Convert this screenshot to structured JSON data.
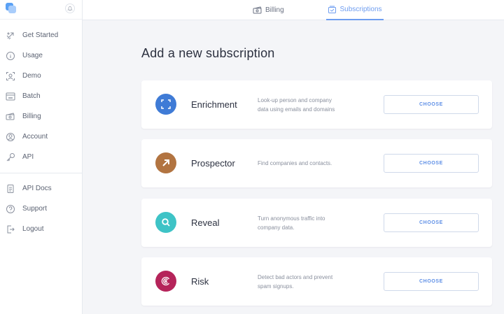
{
  "sidebar": {
    "items": [
      {
        "label": "Get Started",
        "icon": "rocket-icon"
      },
      {
        "label": "Usage",
        "icon": "info-icon"
      },
      {
        "label": "Demo",
        "icon": "person-scan-icon"
      },
      {
        "label": "Batch",
        "icon": "csv-icon"
      },
      {
        "label": "Billing",
        "icon": "money-icon"
      },
      {
        "label": "Account",
        "icon": "user-circle-icon"
      },
      {
        "label": "API",
        "icon": "key-icon"
      }
    ],
    "secondary_items": [
      {
        "label": "API Docs",
        "icon": "document-icon"
      },
      {
        "label": "Support",
        "icon": "help-icon"
      },
      {
        "label": "Logout",
        "icon": "logout-icon"
      }
    ]
  },
  "tabs": [
    {
      "label": "Billing",
      "icon": "money-icon",
      "active": false
    },
    {
      "label": "Subscriptions",
      "icon": "subscriptions-icon",
      "active": true
    }
  ],
  "page": {
    "title": "Add a new subscription"
  },
  "products": [
    {
      "name": "Enrichment",
      "description": "Look-up person and company data using emails and domains",
      "button": "CHOOSE",
      "icon": "enrichment-icon",
      "color": "#3f7bd6"
    },
    {
      "name": "Prospector",
      "description": "Find companies and contacts.",
      "button": "CHOOSE",
      "icon": "prospector-icon",
      "color": "#b27441"
    },
    {
      "name": "Reveal",
      "description": "Turn anonymous traffic into company data.",
      "button": "CHOOSE",
      "icon": "reveal-icon",
      "color": "#3ec3c6"
    },
    {
      "name": "Risk",
      "description": "Detect bad actors and prevent spam signups.",
      "button": "CHOOSE",
      "icon": "risk-icon",
      "color": "#b5245a"
    }
  ],
  "colors": {
    "accent": "#6e9df0",
    "background": "#f4f5f8"
  }
}
